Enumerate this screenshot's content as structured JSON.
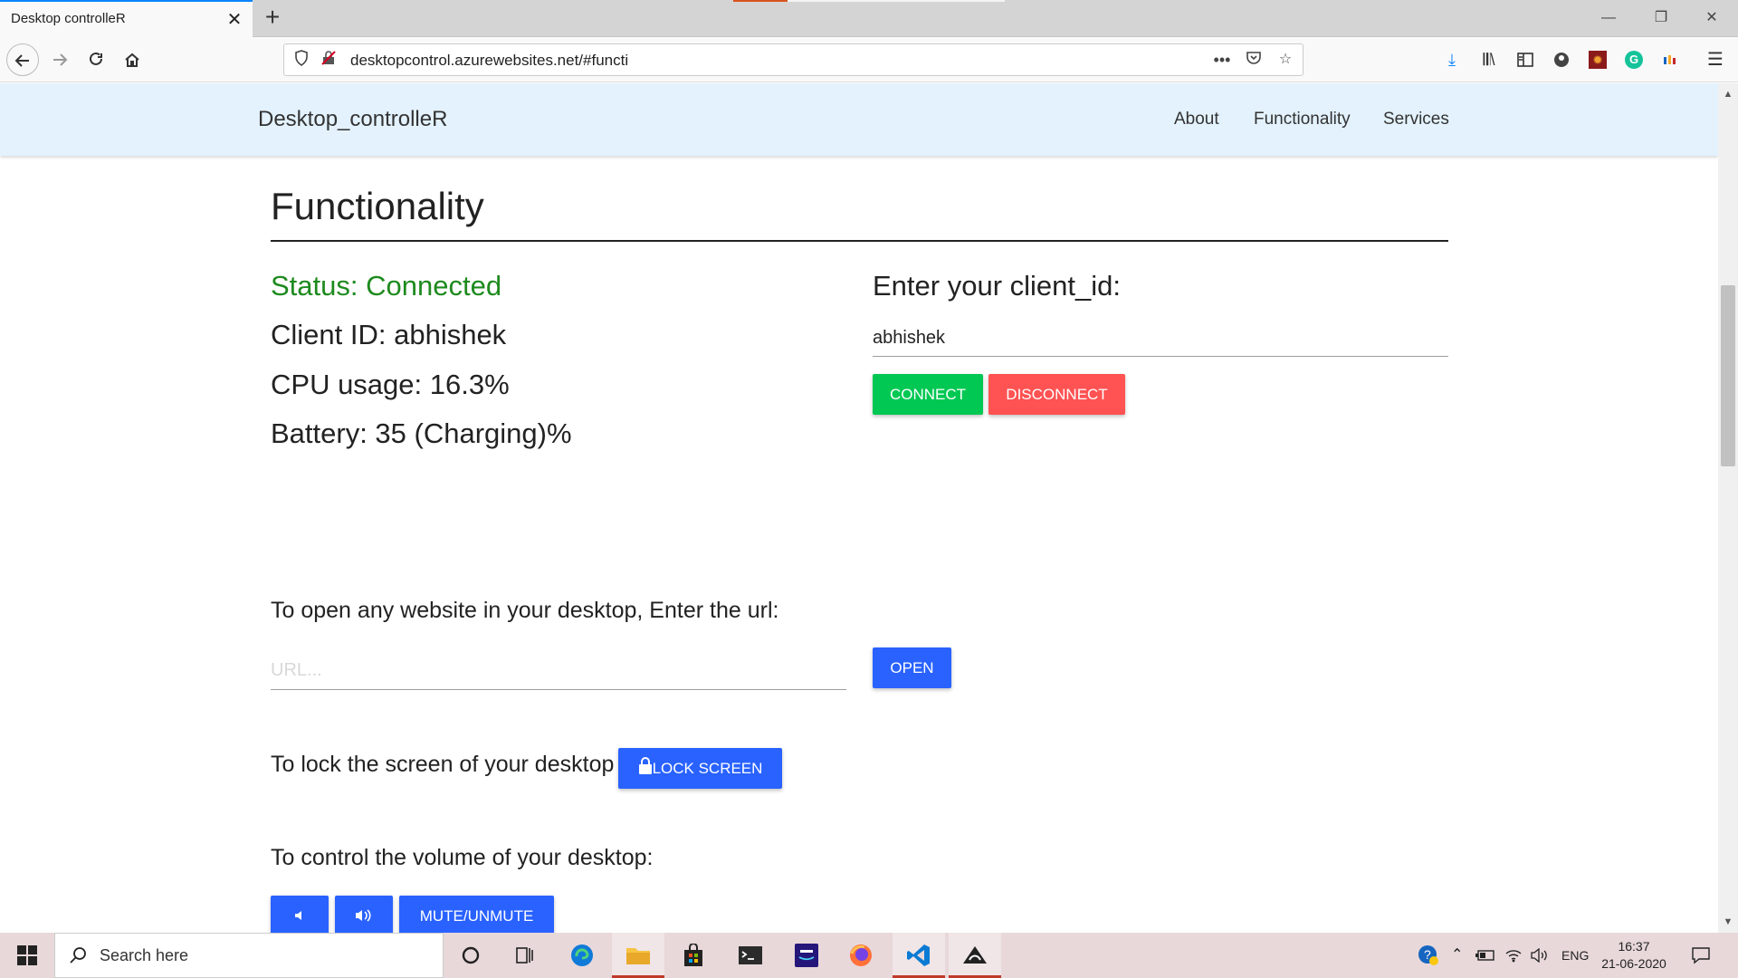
{
  "browser": {
    "tab_title": "Desktop controlleR",
    "tab_close": "✕",
    "new_tab": "+",
    "url": "desktopcontrol.azurewebsites.net/#functi",
    "window_controls": [
      "—",
      "❐",
      "✕"
    ],
    "icons": [
      "back-icon",
      "forward-icon",
      "reload-icon",
      "home-icon",
      "shield-icon",
      "insecure-icon",
      "more-icon",
      "pocket-icon",
      "star-icon",
      "download-icon",
      "library-icon",
      "sidebar-icon",
      "account-icon",
      "extension-icon",
      "grammarly-icon",
      "colors-icon",
      "menu-icon"
    ]
  },
  "site": {
    "brand": "Desktop_controlleR",
    "nav": [
      "About",
      "Functionality",
      "Services"
    ]
  },
  "main": {
    "heading": "Functionality",
    "status": "Status: Connected",
    "client_id": "Client ID: abhishek",
    "cpu": "CPU usage: 16.3%",
    "battery": "Battery: 35 (Charging)%",
    "client_label": "Enter your client_id:",
    "client_value": "abhishek",
    "connect_label": "CONNECT",
    "disconnect_label": "DISCONNECT",
    "url_prompt": "To open any website in your desktop, Enter the url:",
    "url_placeholder": "URL...",
    "open_label": "OPEN",
    "lock_prompt": "To lock the screen of your desktop",
    "lock_label": "LOCK SCREEN",
    "volume_prompt": "To control the volume of your desktop:",
    "mute_label": "MUTE/UNMUTE"
  },
  "taskbar": {
    "search_placeholder": "Search here",
    "language": "ENG",
    "time": "16:37",
    "date": "21-06-2020",
    "apps": [
      "cortana-icon",
      "task-view-icon",
      "edge-icon",
      "file-explorer-icon",
      "store-icon",
      "terminal-icon",
      "amazon-music-icon",
      "firefox-icon",
      "vscode-icon",
      "snip-icon"
    ]
  },
  "colors": {
    "status_green": "#1e8a1e",
    "connect_green": "#00c853",
    "disconnect_red": "#ff5252",
    "action_blue": "#2962ff",
    "header_bg": "#e3f2fd"
  }
}
